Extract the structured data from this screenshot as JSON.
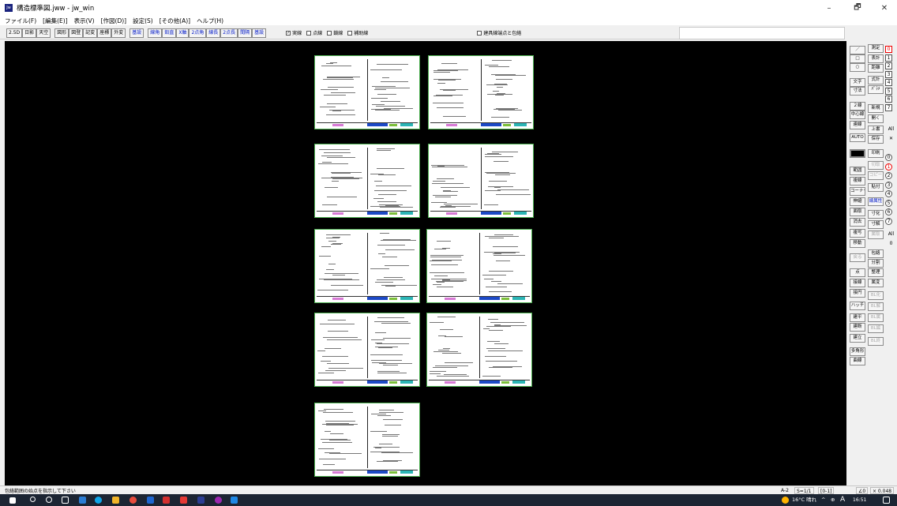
{
  "window": {
    "title": "構造標準図.jww - jw_win",
    "app_icon": "jw-icon",
    "controls": [
      "–",
      "🗗",
      "✕"
    ]
  },
  "menu": [
    "ファイル(F)",
    "[編集(E)]",
    "表示(V)",
    "[作図(D)]",
    "設定(S)",
    "[その他(A)]",
    "ヘルプ(H)"
  ],
  "toolbar": {
    "group1": [
      "2.5D",
      "日影",
      "天空"
    ],
    "group2": [
      "図形",
      "図登",
      "記変",
      "座標",
      "外変"
    ],
    "group3": [
      "基設"
    ],
    "group4": [
      "線角",
      "鉛直",
      "X軸",
      "2点角",
      "線長",
      "2点長",
      "間隔",
      "基設"
    ],
    "checks": [
      {
        "label": "実線",
        "checked": true
      },
      {
        "label": "点線",
        "checked": false
      },
      {
        "label": "鎖線",
        "checked": false
      },
      {
        "label": "補助線",
        "checked": false
      }
    ],
    "extra_check": {
      "label": "建具線端点と包絡",
      "checked": false
    }
  },
  "right_panel": {
    "col1": [
      "／",
      "□",
      "○",
      "文字",
      "寸法",
      "２線",
      "中心線",
      "連線",
      "AUTO",
      "",
      "範囲",
      "複線",
      "コーナー",
      "伸縮",
      "面取",
      "消去",
      "複写",
      "移動",
      "戻る",
      "点",
      "接線",
      "接円",
      "ハッチ",
      "建平",
      "建断",
      "建立",
      "多角形",
      "曲線"
    ],
    "col2": [
      "測定",
      "表計",
      "距離",
      "式計",
      "ﾊﾟﾗﾒ",
      "新規",
      "開く",
      "上書",
      "保存",
      "印刷",
      "切取",
      "コピー",
      "貼付",
      "線属性",
      "寸化",
      "寸解",
      "属取",
      "包絡",
      "分割",
      "整理",
      "属変",
      "BL化",
      "BL解",
      "BL属",
      "BL編",
      "BL終"
    ],
    "layers_top": [
      "0",
      "1",
      "2",
      "3",
      "4",
      "5",
      "6",
      "7"
    ],
    "layers_top_extra": [
      "All",
      "✕"
    ],
    "layers_circle": [
      "0",
      "1",
      "2",
      "3",
      "4",
      "5",
      "6",
      "7"
    ],
    "layers_circle_extra": [
      "All",
      "0"
    ]
  },
  "status": {
    "message": "包絡範囲の始点を指示して下さい",
    "paper": "A-2",
    "scale": "S=1/1",
    "layer": "[0-1]",
    "angle": "∠0",
    "zoom": "× 0.048"
  },
  "taskbar": {
    "weather": "16°C 晴れ",
    "ime": "A",
    "time": "16:51",
    "system_icons": [
      "^",
      "⊕"
    ]
  },
  "sheets": 9
}
